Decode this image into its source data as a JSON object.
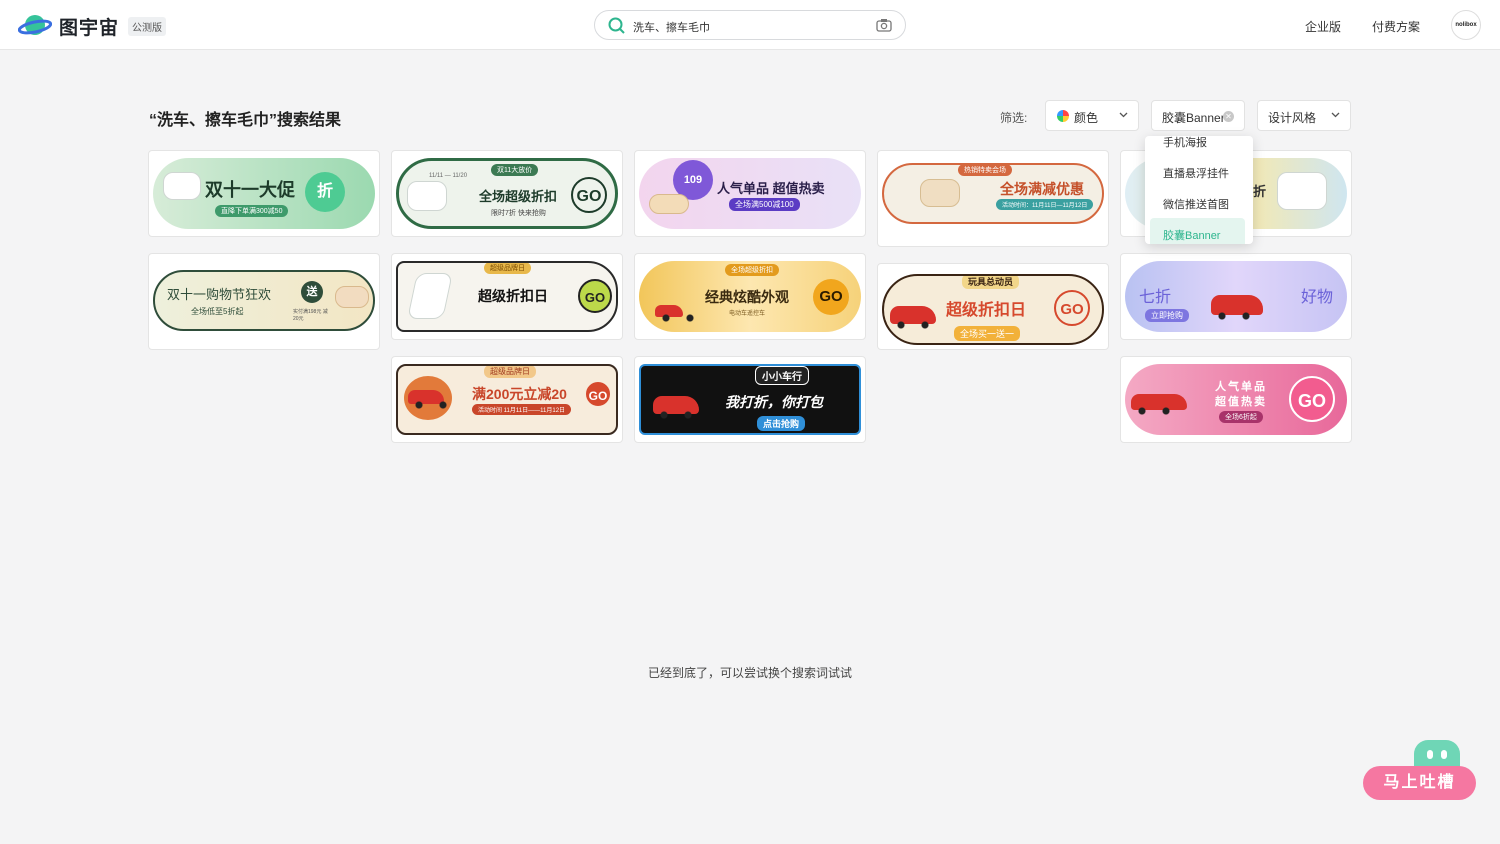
{
  "header": {
    "brand": "图宇宙",
    "beta_badge": "公测版",
    "search_value": "洗车、擦车毛巾",
    "nav_enterprise": "企业版",
    "nav_pricing": "付费方案",
    "avatar_text": "nolibox"
  },
  "results": {
    "title": "“洗车、擦车毛巾”搜索结果",
    "filter_label": "筛选:",
    "filters": {
      "color": "颜色",
      "type": "胶囊Banner",
      "style": "设计风格"
    },
    "dropdown": [
      "手机海报",
      "直播悬浮挂件",
      "微信推送首图",
      "胶囊Banner"
    ],
    "end_text": "已经到底了，可以尝试换个搜索词试试"
  },
  "cards": {
    "c1": {
      "title": "双十一大促",
      "sub": "直降下单满300减50",
      "go": "折"
    },
    "c2": {
      "tag": "双11大放价",
      "date": "11/11 — 11/20",
      "title": "全场超级折扣",
      "sub": "限时7折 快来抢购",
      "go": "GO"
    },
    "c3": {
      "badge": "109",
      "title": "人气单品 超值热卖",
      "sub": "全场满500减100"
    },
    "c4": {
      "tag": "热销特卖会场",
      "title": "全场满减优惠",
      "sub": "活动时间：11月11日—11月12日"
    },
    "c5": {
      "title": "折"
    },
    "c6": {
      "title": "双十一购物节狂欢",
      "sub": "全场低至5折起",
      "go": "送",
      "note": "实付满198元 减20元"
    },
    "c7": {
      "tag": "超级品牌日",
      "title": "超级折扣日",
      "go": "GO"
    },
    "c8": {
      "tag": "全场超级折扣",
      "title": "经典炫酷外观",
      "sub": "电动车遥控车",
      "go": "GO"
    },
    "c9": {
      "tag": "玩具总动员",
      "title": "超级折扣日",
      "sub": "全场买一送一",
      "go": "GO"
    },
    "c10": {
      "left": "七折",
      "sub": "立即抢购",
      "right": "好物"
    },
    "c11": {
      "tag": "超级品牌日",
      "title": "满200元立减20",
      "sub": "活动时间 11月11日——11月12日",
      "go": "GO"
    },
    "c12": {
      "tag": "小小车行",
      "title": "我打折，你打包",
      "sub": "点击抢购"
    },
    "c13": {
      "title": "人气单品",
      "title2": "超值热卖",
      "sub": "全场6折起",
      "go": "GO"
    }
  },
  "feedback": {
    "label": "马上吐槽"
  }
}
